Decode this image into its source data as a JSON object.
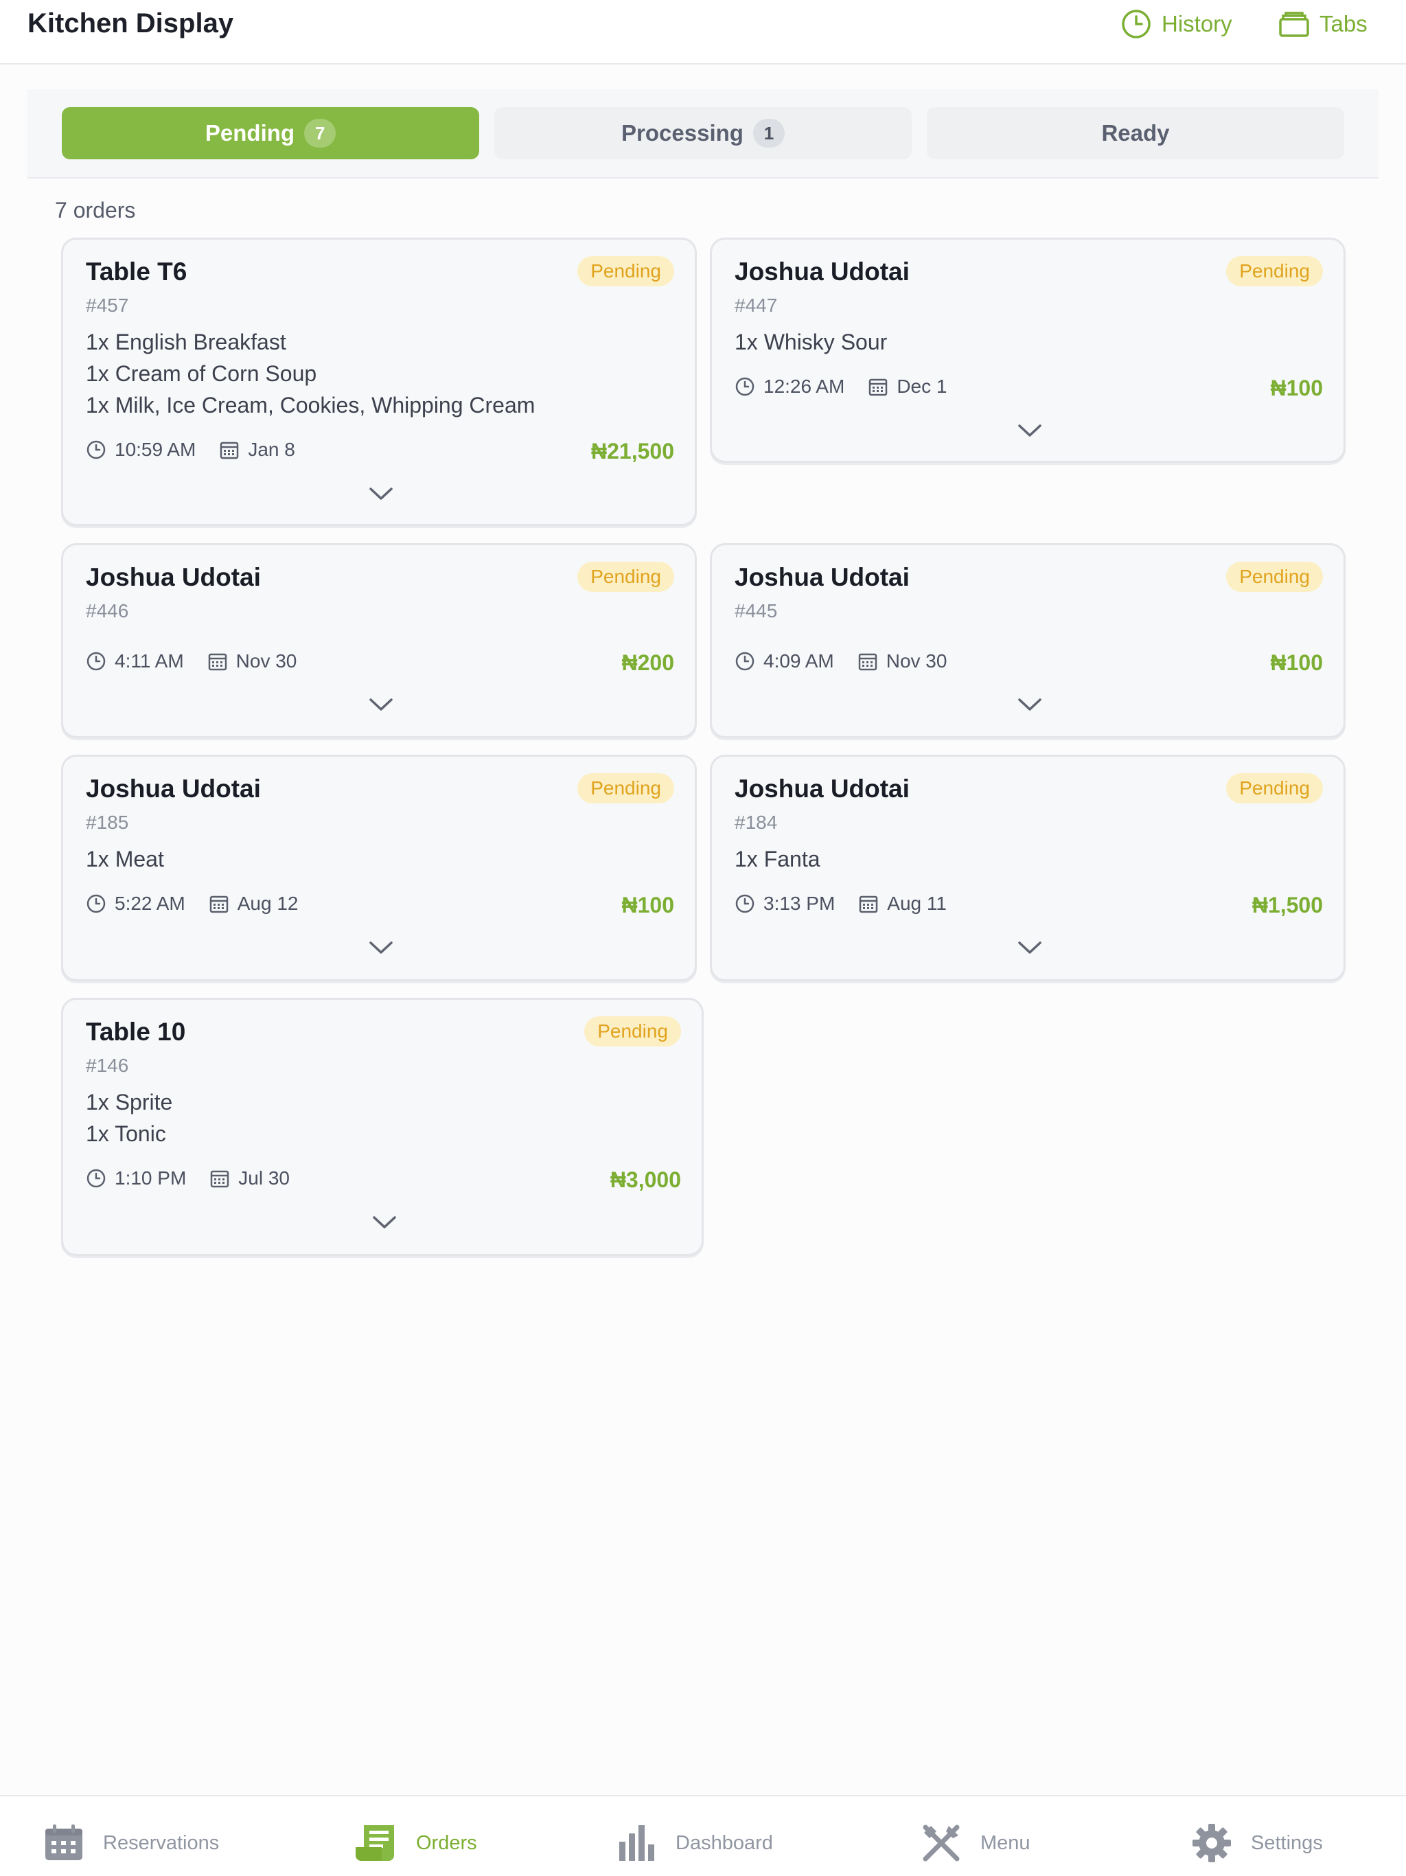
{
  "app": {
    "title": "Kitchen Display"
  },
  "header": {
    "history_label": "History",
    "tabs_label": "Tabs"
  },
  "status_tabs": [
    {
      "label": "Pending",
      "count": "7",
      "active": true
    },
    {
      "label": "Processing",
      "count": "1",
      "active": false
    },
    {
      "label": "Ready",
      "count": null,
      "active": false
    }
  ],
  "summary": {
    "order_count_text": "7 orders"
  },
  "orders": [
    {
      "title": "Table T6",
      "id": "#457",
      "status": "Pending",
      "items": [
        "1x English Breakfast",
        "1x Cream of Corn Soup",
        "1x Milk, Ice Cream, Cookies, Whipping Cream"
      ],
      "time": "10:59 AM",
      "date": "Jan 8",
      "total": "₦21,500"
    },
    {
      "title": "Joshua Udotai",
      "id": "#447",
      "status": "Pending",
      "items": [
        "1x Whisky Sour"
      ],
      "time": "12:26 AM",
      "date": "Dec 1",
      "total": "₦100"
    },
    {
      "title": "Joshua Udotai",
      "id": "#446",
      "status": "Pending",
      "items": [],
      "time": "4:11 AM",
      "date": "Nov 30",
      "total": "₦200"
    },
    {
      "title": "Joshua Udotai",
      "id": "#445",
      "status": "Pending",
      "items": [],
      "time": "4:09 AM",
      "date": "Nov 30",
      "total": "₦100"
    },
    {
      "title": "Joshua Udotai",
      "id": "#185",
      "status": "Pending",
      "items": [
        "1x Meat"
      ],
      "time": "5:22 AM",
      "date": "Aug 12",
      "total": "₦100"
    },
    {
      "title": "Joshua Udotai",
      "id": "#184",
      "status": "Pending",
      "items": [
        "1x Fanta"
      ],
      "time": "3:13 PM",
      "date": "Aug 11",
      "total": "₦1,500"
    },
    {
      "title": "Table 10",
      "id": "#146",
      "status": "Pending",
      "items": [
        "1x Sprite",
        "1x Tonic"
      ],
      "time": "1:10 PM",
      "date": "Jul 30",
      "total": "₦3,000"
    }
  ],
  "bottom_nav": [
    {
      "label": "Reservations",
      "icon": "calendar-icon",
      "active": false
    },
    {
      "label": "Orders",
      "icon": "receipt-icon",
      "active": true
    },
    {
      "label": "Dashboard",
      "icon": "bar-chart-icon",
      "active": false
    },
    {
      "label": "Menu",
      "icon": "utensils-icon",
      "active": false
    },
    {
      "label": "Settings",
      "icon": "gear-icon",
      "active": false
    }
  ],
  "colors": {
    "accent": "#86b943",
    "accent_text": "#7bae32",
    "pending_badge_bg": "#fdefc4",
    "pending_badge_text": "#e0a31e"
  }
}
